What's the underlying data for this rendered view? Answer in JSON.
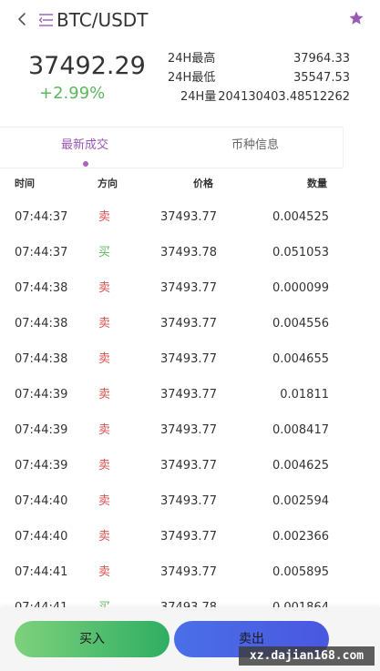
{
  "header": {
    "pair": "BTC/USDT"
  },
  "summary": {
    "last_price": "37492.29",
    "change": "+2.99%",
    "high_label": "24H最高",
    "high_value": "37964.33",
    "low_label": "24H最低",
    "low_value": "35547.53",
    "volume_label": "24H量",
    "volume_value": "204130403.48512262"
  },
  "tabs": [
    {
      "label": "最新成交",
      "active": true
    },
    {
      "label": "币种信息",
      "active": false
    }
  ],
  "table": {
    "columns": [
      "时间",
      "方向",
      "价格",
      "数量"
    ],
    "rows": [
      {
        "time": "07:44:37",
        "side": "卖",
        "price": "37493.77",
        "qty": "0.004525"
      },
      {
        "time": "07:44:37",
        "side": "买",
        "price": "37493.78",
        "qty": "0.051053"
      },
      {
        "time": "07:44:38",
        "side": "卖",
        "price": "37493.77",
        "qty": "0.000099"
      },
      {
        "time": "07:44:38",
        "side": "卖",
        "price": "37493.77",
        "qty": "0.004556"
      },
      {
        "time": "07:44:38",
        "side": "卖",
        "price": "37493.77",
        "qty": "0.004655"
      },
      {
        "time": "07:44:39",
        "side": "卖",
        "price": "37493.77",
        "qty": "0.01811"
      },
      {
        "time": "07:44:39",
        "side": "卖",
        "price": "37493.77",
        "qty": "0.008417"
      },
      {
        "time": "07:44:39",
        "side": "卖",
        "price": "37493.77",
        "qty": "0.004625"
      },
      {
        "time": "07:44:40",
        "side": "卖",
        "price": "37493.77",
        "qty": "0.002594"
      },
      {
        "time": "07:44:40",
        "side": "卖",
        "price": "37493.77",
        "qty": "0.002366"
      },
      {
        "time": "07:44:41",
        "side": "卖",
        "price": "37493.77",
        "qty": "0.005895"
      },
      {
        "time": "07:44:41",
        "side": "买",
        "price": "37493.78",
        "qty": "0.001864"
      }
    ]
  },
  "actions": {
    "buy_label": "买入",
    "sell_label": "卖出"
  },
  "watermark": "xz.dajian168.com",
  "colors": {
    "accent": "#9b59b6",
    "buy": "#5cb85c",
    "sell": "#d9534f",
    "star": "#9b59b6"
  },
  "icons": {
    "back": "chevron-left-icon",
    "menu": "menu-icon",
    "favorite": "star-icon"
  }
}
